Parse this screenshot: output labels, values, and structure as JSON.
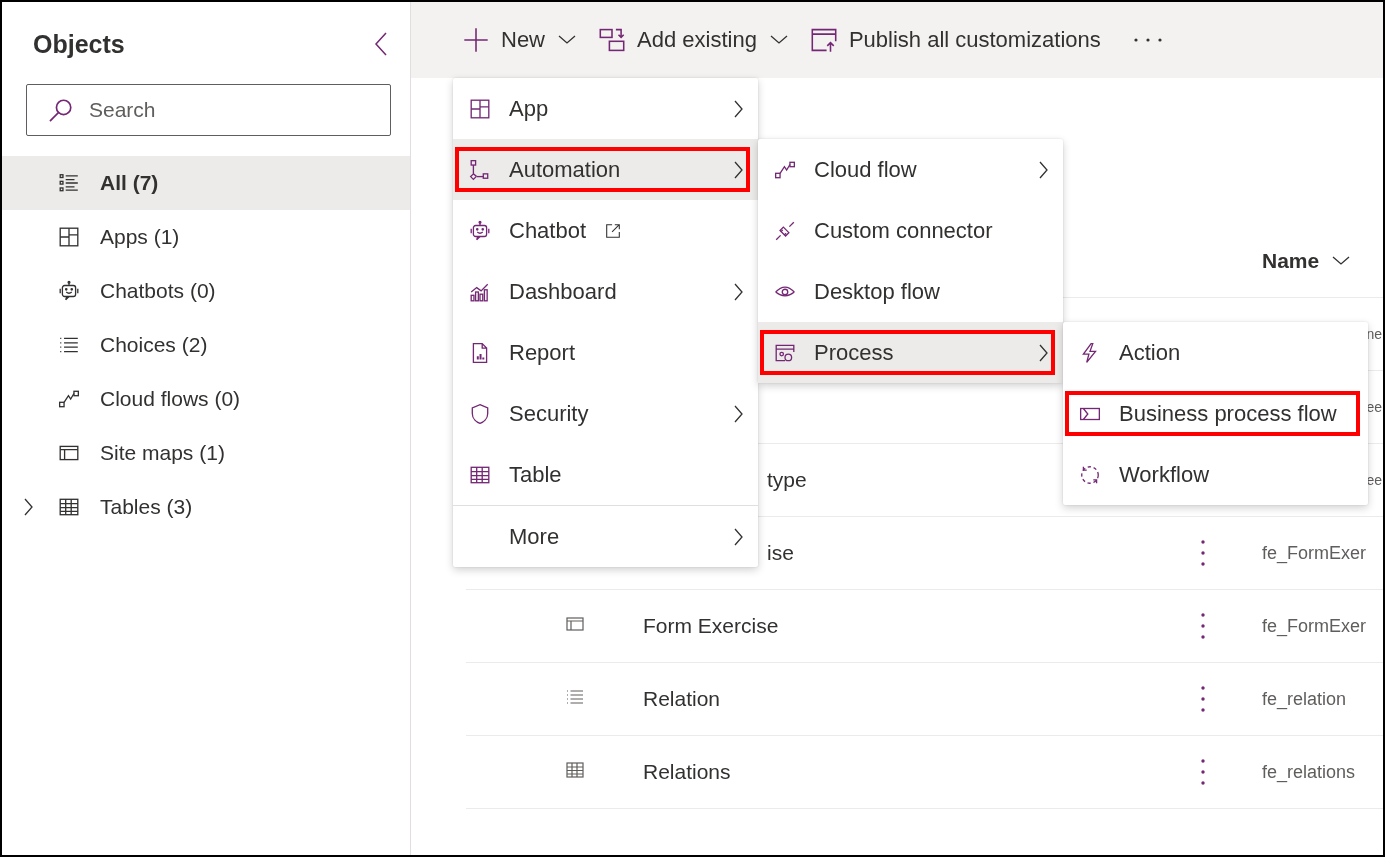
{
  "sidebar": {
    "title": "Objects",
    "search": {
      "placeholder": "Search"
    },
    "items": [
      {
        "label": "All (7)",
        "selected": true
      },
      {
        "label": "Apps (1)",
        "selected": false
      },
      {
        "label": "Chatbots (0)",
        "selected": false
      },
      {
        "label": "Choices (2)",
        "selected": false
      },
      {
        "label": "Cloud flows (0)",
        "selected": false
      },
      {
        "label": "Site maps (1)",
        "selected": false
      },
      {
        "label": "Tables (3)",
        "selected": false,
        "expanded": false
      }
    ]
  },
  "toolbar": [
    {
      "label": "New",
      "dropdown": true
    },
    {
      "label": "Add existing",
      "dropdown": true
    },
    {
      "label": "Publish all customizations",
      "dropdown": false
    }
  ],
  "table": {
    "header": "Name",
    "rows": [
      {
        "logical_name": "ne",
        "logical_partial": true
      },
      {
        "logical_name": "ee",
        "logical_partial": true
      },
      {
        "name": "type",
        "name_partial": true,
        "logical_name": "ee",
        "logical_partial": true
      },
      {
        "name": "ise",
        "name_partial": true,
        "logical_name": "fe_FormExer",
        "logical_partial": false
      },
      {
        "kind": "form",
        "name": "Form Exercise",
        "name_partial": false,
        "logical_name": "fe_FormExer",
        "logical_partial": false
      },
      {
        "kind": "choice",
        "name": "Relation",
        "name_partial": false,
        "logical_name": "fe_relation",
        "logical_partial": false
      },
      {
        "kind": "table",
        "name": "Relations",
        "name_partial": false,
        "logical_name": "fe_relations",
        "logical_partial": false
      }
    ]
  },
  "menus": [
    {
      "items": [
        {
          "label": "App",
          "submenu": true,
          "selected": false,
          "highlighted": false
        },
        {
          "label": "Automation",
          "submenu": true,
          "selected": true,
          "highlighted": true
        },
        {
          "label": "Chatbot",
          "submenu": false,
          "external": true,
          "selected": false,
          "highlighted": false
        },
        {
          "label": "Dashboard",
          "submenu": true,
          "selected": false,
          "highlighted": false
        },
        {
          "label": "Report",
          "submenu": false,
          "selected": false,
          "highlighted": false
        },
        {
          "label": "Security",
          "submenu": true,
          "selected": false,
          "highlighted": false
        },
        {
          "label": "Table",
          "submenu": false,
          "selected": false,
          "highlighted": false
        }
      ],
      "footer_items": [
        {
          "label": "More",
          "submenu": true,
          "selected": false,
          "highlighted": false
        }
      ]
    },
    {
      "items": [
        {
          "label": "Cloud flow",
          "submenu": true,
          "selected": false,
          "highlighted": false
        },
        {
          "label": "Custom connector",
          "submenu": false,
          "selected": false,
          "highlighted": false
        },
        {
          "label": "Desktop flow",
          "submenu": false,
          "selected": false,
          "highlighted": false
        },
        {
          "label": "Process",
          "submenu": true,
          "selected": true,
          "highlighted": true
        }
      ]
    },
    {
      "items": [
        {
          "label": "Action",
          "submenu": false,
          "selected": false,
          "highlighted": false
        },
        {
          "label": "Business process flow",
          "submenu": false,
          "selected": false,
          "highlighted": true
        },
        {
          "label": "Workflow",
          "submenu": false,
          "selected": false,
          "highlighted": false
        }
      ]
    }
  ]
}
